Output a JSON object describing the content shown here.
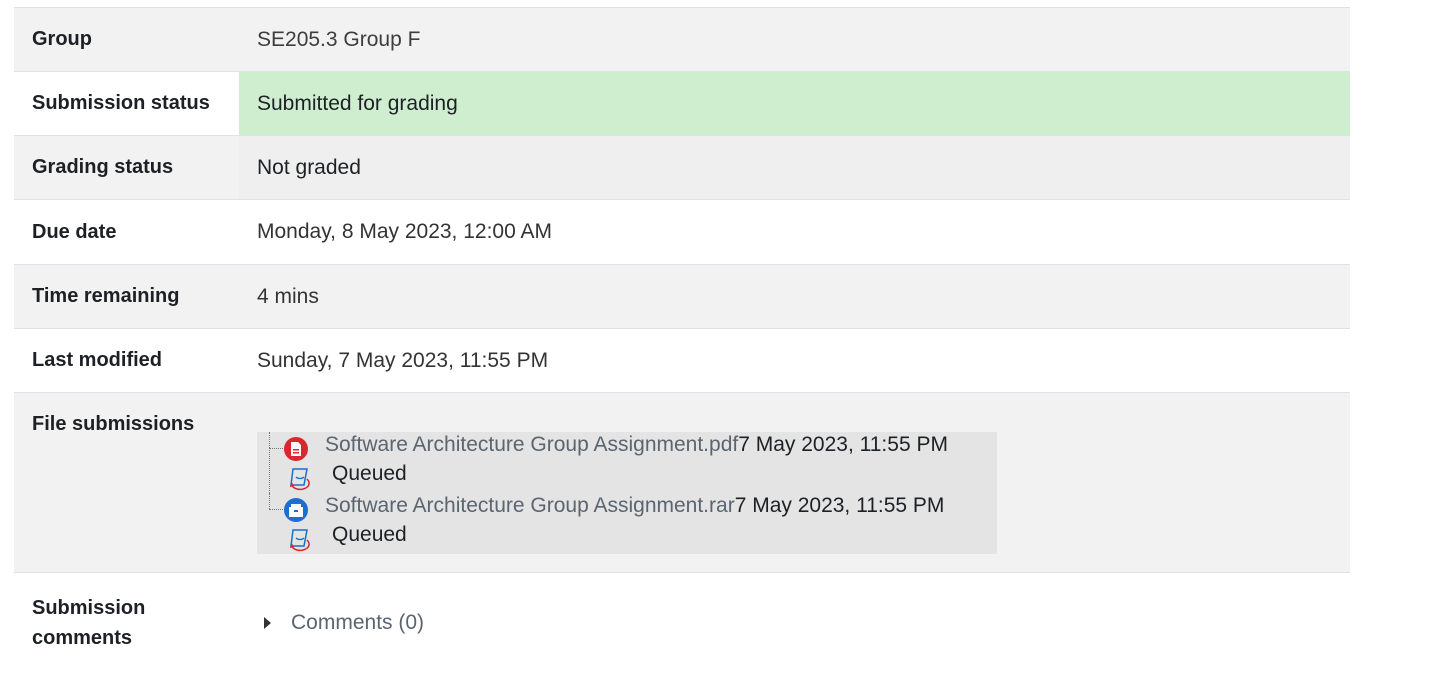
{
  "rows": {
    "group": {
      "label": "Group",
      "value": "SE205.3 Group F"
    },
    "submission_status": {
      "label": "Submission status",
      "value": "Submitted for grading"
    },
    "grading_status": {
      "label": "Grading status",
      "value": "Not graded"
    },
    "due_date": {
      "label": "Due date",
      "value": "Monday, 8 May 2023, 12:00 AM"
    },
    "time_remaining": {
      "label": "Time remaining",
      "value": "4 mins"
    },
    "last_modified": {
      "label": "Last modified",
      "value": "Sunday, 7 May 2023, 11:55 PM"
    },
    "file_submissions": {
      "label": "File submissions",
      "files": [
        {
          "name": "Software Architecture Group Assignment.pdf",
          "date": "7 May 2023, 11:55 PM",
          "status": "Queued",
          "icon": "pdf-file-icon"
        },
        {
          "name": "Software Architecture Group Assignment.rar",
          "date": "7 May 2023, 11:55 PM",
          "status": "Queued",
          "icon": "archive-file-icon"
        }
      ]
    },
    "submission_comments": {
      "label_line1": "Submission",
      "label_line2": "comments",
      "link": "Comments (0)"
    }
  },
  "colors": {
    "submitted_bg": "#cfeecf",
    "alt_row_bg": "#f2f2f2",
    "pdf_icon": "#d9262f",
    "archive_icon": "#1a6fd0",
    "queued_icon": "#1a6fd0"
  }
}
